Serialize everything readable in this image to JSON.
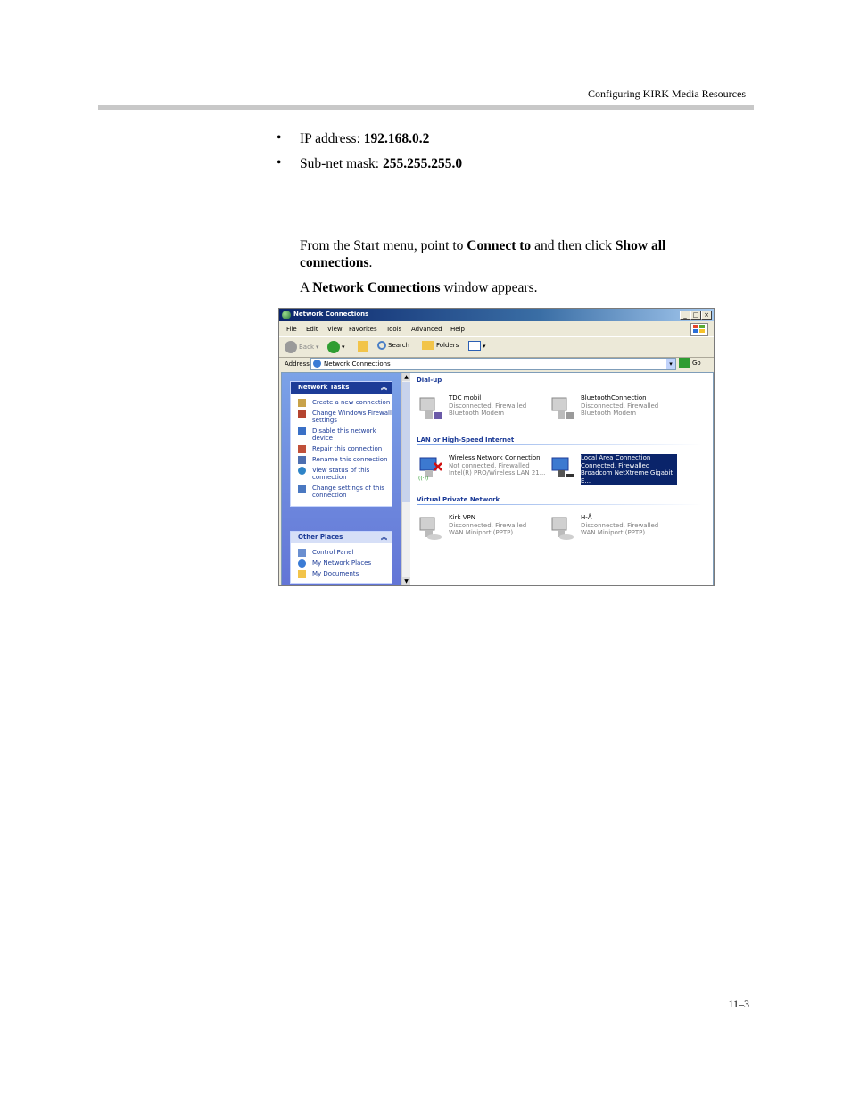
{
  "page_header": "Configuring KIRK Media Resources",
  "bullets": [
    {
      "label": "IP address: ",
      "value": "192.168.0.2"
    },
    {
      "label": "Sub-net mask: ",
      "value": "255.255.255.0"
    }
  ],
  "instruction": {
    "p1": "From the Start menu, point to ",
    "b1": "Connect to",
    "p2": " and then click ",
    "b2": "Show all connections",
    "p3": "."
  },
  "result": {
    "p1": "A ",
    "b1": "Network Connections",
    "p2": " window appears."
  },
  "page_number": "11–3",
  "window": {
    "title": "Network Connections",
    "menu": [
      "File",
      "Edit",
      "View",
      "Favorites",
      "Tools",
      "Advanced",
      "Help"
    ],
    "toolbar": {
      "back": "Back",
      "search": "Search",
      "folders": "Folders"
    },
    "address_label": "Address",
    "address_value": "Network Connections",
    "go": "Go",
    "network_tasks": {
      "title": "Network Tasks",
      "items": [
        "Create a new connection",
        "Change Windows Firewall settings",
        "Disable this network device",
        "Repair this connection",
        "Rename this connection",
        "View status of this connection",
        "Change settings of this connection"
      ]
    },
    "other_places": {
      "title": "Other Places",
      "items": [
        "Control Panel",
        "My Network Places",
        "My Documents"
      ]
    },
    "groups": [
      {
        "title": "Dial-up",
        "items": [
          {
            "name": "TDC mobil",
            "status": "Disconnected, Firewalled",
            "device": "Bluetooth Modem"
          },
          {
            "name": "BluetoothConnection",
            "status": "Disconnected, Firewalled",
            "device": "Bluetooth Modem"
          }
        ]
      },
      {
        "title": "LAN or High-Speed Internet",
        "items": [
          {
            "name": "Wireless Network Connection",
            "status": "Not connected, Firewalled",
            "device": "Intel(R) PRO/Wireless LAN 21..."
          },
          {
            "name": "Local Area Connection",
            "status": "Connected, Firewalled",
            "device": "Broadcom NetXtreme Gigabit E..."
          }
        ]
      },
      {
        "title": "Virtual Private Network",
        "items": [
          {
            "name": "Kirk VPN",
            "status": "Disconnected, Firewalled",
            "device": "WAN Miniport (PPTP)"
          },
          {
            "name": "H-Å",
            "status": "Disconnected, Firewalled",
            "device": "WAN Miniport (PPTP)"
          }
        ]
      }
    ]
  }
}
